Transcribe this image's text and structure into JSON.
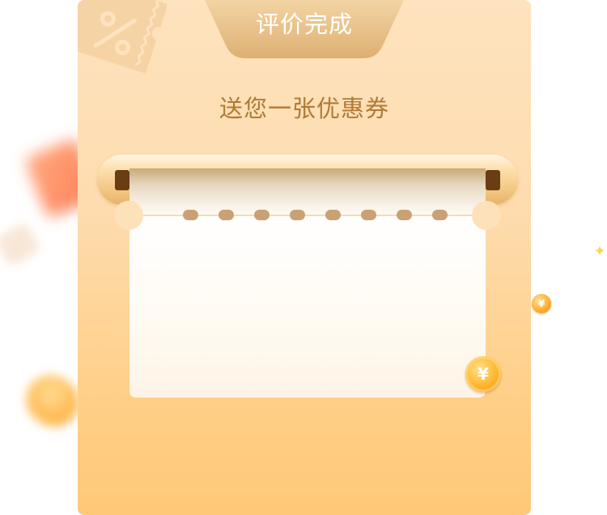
{
  "modal": {
    "header_tab": "评价完成",
    "subtitle": "送您一张优惠券"
  },
  "icons": {
    "watermark": "percent-coupon-icon",
    "coin": "yuan-coin-icon",
    "sparkle": "sparkle-icon"
  },
  "glyphs": {
    "coin_symbol": "¥",
    "sparkle_symbol": "✦"
  },
  "colors": {
    "card_top": "#fde3be",
    "card_bottom": "#ffc877",
    "tab_gradient_top": "#f3d4a3",
    "tab_gradient_bottom": "#ddb073",
    "subtitle_text": "#b07a33",
    "scroll_bar": "#f3c682",
    "coupon_paper": "#fffaf2",
    "perforation_dot": "#c9a173",
    "coin": "#ffb62e"
  }
}
